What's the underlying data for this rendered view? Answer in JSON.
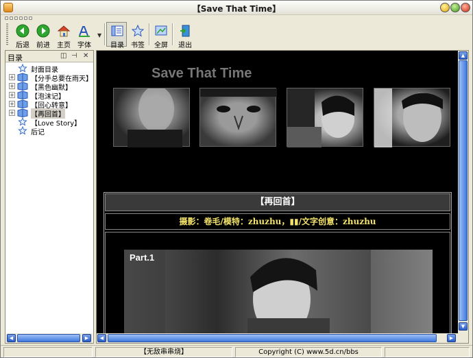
{
  "window": {
    "title": "【Save That Time】"
  },
  "toolbar": {
    "back_label": "后退",
    "forward_label": "前进",
    "home_label": "主页",
    "font_label": "字体",
    "toc_label": "目录",
    "bookmark_label": "书签",
    "fullscreen_label": "全屏",
    "exit_label": "退出"
  },
  "sidebar": {
    "title": "目录",
    "items": [
      {
        "label": "封面目录",
        "expandable": false
      },
      {
        "label": "【分手总要在雨天】",
        "expandable": true
      },
      {
        "label": "【黑色幽默】",
        "expandable": true
      },
      {
        "label": "【泡沫记】",
        "expandable": true
      },
      {
        "label": "【回心转意】",
        "expandable": true
      },
      {
        "label": "【再回首】",
        "expandable": true,
        "selected": true
      },
      {
        "label": "【Love Story】",
        "expandable": false
      },
      {
        "label": "后记",
        "expandable": false
      }
    ]
  },
  "content": {
    "header_title": "Save That Time",
    "section_title": "【再回首】",
    "credits": "摄影：卷毛/模特：zhuzhu，▮▮/文字创意：zhuzhu",
    "part_label": "Part.1"
  },
  "statusbar": {
    "left": "【无敌串串烧】",
    "right": "Copyright (C) www.5d.cn/bbs"
  }
}
